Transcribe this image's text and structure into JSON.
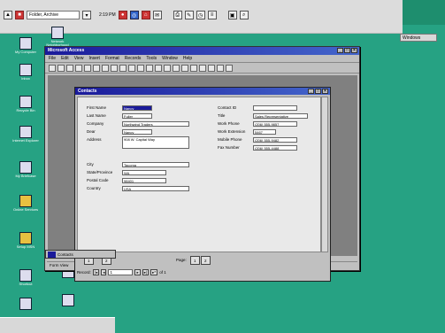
{
  "taskbar": {
    "field_value": "Folder, Archive",
    "clock": "2:19 PM"
  },
  "right_tab_label": "Windows",
  "desktop_icons": [
    {
      "label": "My Computer",
      "icon": "computer-icon"
    },
    {
      "label": "Network Neighborhood",
      "icon": "network-icon"
    },
    {
      "label": "Inbox",
      "icon": "inbox-icon"
    },
    {
      "label": "Recycle Bin",
      "icon": "recycle-bin-icon"
    },
    {
      "label": "Internet Explorer",
      "icon": "globe-icon"
    },
    {
      "label": "My Briefcase",
      "icon": "briefcase-icon"
    },
    {
      "label": "Online Services",
      "icon": "folder-icon"
    },
    {
      "label": "Setup MSN",
      "icon": "msn-icon"
    },
    {
      "label": "Shortcut",
      "icon": "shortcut-icon"
    }
  ],
  "window": {
    "title": "Microsoft Access",
    "menu": [
      "File",
      "Edit",
      "View",
      "Insert",
      "Format",
      "Records",
      "Tools",
      "Window",
      "Help"
    ],
    "status_left": "Form View",
    "status_right": "NUM"
  },
  "form": {
    "title": "Contacts",
    "fields_left": [
      {
        "label": "First Name",
        "value": "Nancy"
      },
      {
        "label": "Last Name",
        "value": "Fuller"
      },
      {
        "label": "Company",
        "value": "Northwind Traders"
      },
      {
        "label": "Dear",
        "value": "Nancy"
      },
      {
        "label": "Address",
        "value": "908 W. Capital Way"
      }
    ],
    "fields_left2": [
      {
        "label": "City",
        "value": "Tacoma"
      },
      {
        "label": "State/Province",
        "value": "WA"
      },
      {
        "label": "Postal Code",
        "value": "98401"
      },
      {
        "label": "Country",
        "value": "USA"
      }
    ],
    "fields_right": [
      {
        "label": "Contact ID",
        "value": ""
      },
      {
        "label": "Title",
        "value": "Sales Representative"
      },
      {
        "label": "Work Phone",
        "value": "(206) 555-9857"
      },
      {
        "label": "Work Extension",
        "value": "5467"
      },
      {
        "label": "Mobile Phone",
        "value": "(206) 555-9482"
      },
      {
        "label": "Fax Number",
        "value": "(206) 555-4488"
      }
    ],
    "page_label": "Page:",
    "buttons": {
      "prev": "1",
      "next": "2"
    },
    "record_label": "Record:",
    "record_value": "1",
    "record_total": "of 1"
  },
  "mini_window": "Contacts"
}
